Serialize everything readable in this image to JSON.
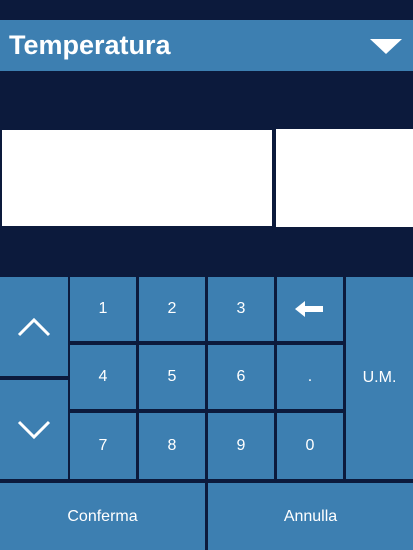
{
  "header": {
    "title": "Temperatura",
    "dropdown_icon": "triangle-down-icon"
  },
  "display": {
    "value": "",
    "unit": ""
  },
  "keypad": {
    "up_icon": "chevron-up-icon",
    "down_icon": "chevron-down-icon",
    "backspace_icon": "arrow-left-icon",
    "digits": [
      "1",
      "2",
      "3",
      "4",
      "5",
      "6",
      "7",
      "8",
      "9",
      "0"
    ],
    "decimal": ".",
    "unit_label": "U.M.",
    "confirm_label": "Conferma",
    "cancel_label": "Annulla"
  },
  "colors": {
    "background": "#0c1a3c",
    "accent": "#3d7fb1",
    "text": "#ffffff"
  }
}
